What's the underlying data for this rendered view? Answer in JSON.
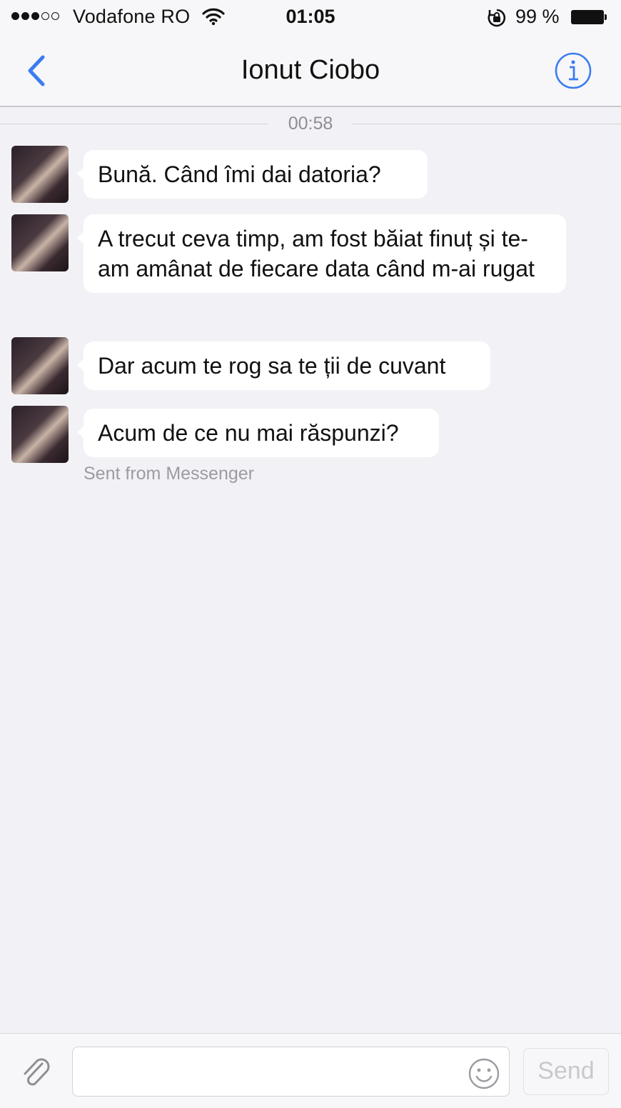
{
  "status_bar": {
    "carrier": "Vodafone RO",
    "time": "01:05",
    "battery_percent": "99 %",
    "signal_bars": 3,
    "signal_total": 5,
    "battery_level": 0.99
  },
  "nav": {
    "title": "Ionut Ciobo",
    "back_icon": "chevron-left-icon",
    "info_icon": "info-circle-icon",
    "accent_color": "#3b7cf0"
  },
  "conversation": {
    "timestamp": "00:58",
    "messages": [
      {
        "text": "Bună.  Când îmi dai datoria?"
      },
      {
        "text": "A trecut ceva timp, am fost băiat finuț și te-am amânat de fiecare data când m-ai rugat"
      },
      {
        "text": "Dar acum te rog sa te ții de cuvant"
      },
      {
        "text": "Acum de ce nu mai răspunzi?"
      }
    ],
    "footer_note": "Sent from Messenger"
  },
  "composer": {
    "placeholder": "",
    "send_label": "Send",
    "attach_icon": "paperclip-icon",
    "emoji_icon": "smiley-icon"
  }
}
